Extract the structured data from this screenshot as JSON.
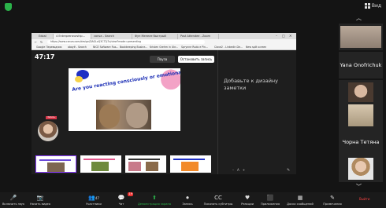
{
  "top": {
    "view_label": "Вид"
  },
  "browser": {
    "tabs": [
      "Edoal",
      "4 Entrepreneurship...",
      "canva - Search",
      "Фун Менеле быстрый",
      "Post Attendee - Zoom"
    ],
    "address": "https://www.canva.com/design/DAGLxQ3C72j7s/view?mode=presenting",
    "bookmarks": [
      "Google Переводчик",
      "abayê - Search",
      "NICE Software Rus...",
      "Bookkeeping Busine...",
      "Kristen Grehm in Ukr...",
      "Sprynne Rudo e Pin...",
      "Clave2 - LinkedIn De...",
      "New split screen"
    ]
  },
  "canva": {
    "timer": "47:17",
    "pause_label": "Пауза",
    "stop_label": "Остановить запись",
    "notes_placeholder": "Добавьте к дизайну заметки",
    "slide_title": "Are you reacting consciously or emotionally?",
    "presenter_tag": "Запись",
    "notes_tools": [
      "–",
      "A",
      "+"
    ]
  },
  "participants": {
    "tiles": [
      "",
      "Yana Onofrichuk",
      "",
      "",
      "Чорна Тетяна",
      ""
    ]
  },
  "toolbar": {
    "items": [
      {
        "icon": "🎤",
        "label": "Включить звук"
      },
      {
        "icon": "📷",
        "label": "Начать видео"
      },
      {
        "icon": "👥",
        "label": "Участники"
      },
      {
        "icon": "💬",
        "label": "Чат"
      },
      {
        "icon": "⬆",
        "label": "Демонстрация экрана"
      },
      {
        "icon": "⏺",
        "label": "Запись"
      },
      {
        "icon": "CC",
        "label": "Показать субтитры"
      },
      {
        "icon": "♥",
        "label": "Реакции"
      },
      {
        "icon": "⬛",
        "label": "Приложения"
      },
      {
        "icon": "▦",
        "label": "Доска сообщений"
      },
      {
        "icon": "✎",
        "label": "Примечания"
      }
    ],
    "participants_count": "47",
    "chat_badge": "19",
    "leave_label": "Выйти"
  },
  "colors": {
    "share_green": "#2bb34a",
    "canva_purple": "#8b3dff",
    "leave_red": "#ff4444"
  }
}
